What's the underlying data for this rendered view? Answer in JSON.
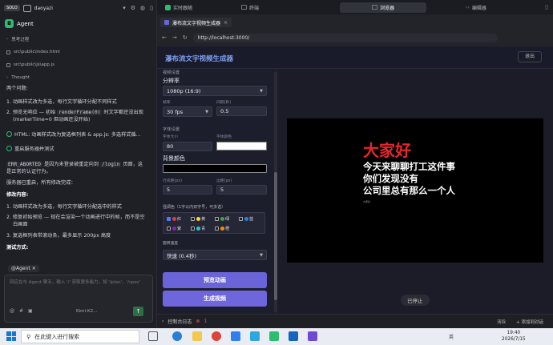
{
  "left": {
    "solo": "SOLO",
    "user": "daoyazi",
    "agent_title": "Agent",
    "think": "思考过程",
    "files": [
      "src\\public\\index.html",
      "src\\public\\js\\app.js"
    ],
    "thought": "Thought",
    "lines": {
      "q": "两个问题:",
      "l1": "1. 动画样式改为多选，每行文字循环分配不同样式",
      "l2": "2. 预览无响应 — 初始",
      "l2code": "renderFrame(0)",
      "l2b": "时文字都还没出现",
      "l2c": "(markerTime=0 但动画还没开始)",
      "html_item": "HTML: 动画样式改为复选框列表 & app.js: 多选样式循...",
      "restart": "重启服务器并测试",
      "aborted_code": "ERR_ABORTED",
      "aborted": "是因为未登录被重定向到",
      "login_code": "/login",
      "aborted2": "页面，这",
      "aborted3": "是正常的认证行为。",
      "updated": "服务器已重启，所有修改完成：",
      "mod_title": "修改内容:",
      "m1": "1. 动画样式改为多选，每行文字循环分配选中的样式",
      "m2": "2. 修复初始预览 — 现在会渲染一个动画进行中的帧，而不是空",
      "m2b": "白画面",
      "m3": "3. 复选框列表带滚动条，最多显示 200px 高度",
      "test": "测试方式:"
    },
    "chat_chip": "@Agent",
    "chat_placeholder": "回应在与 Agent 聊天，输入 '/' 获取更多能力。如 '/plan'、'/spec'",
    "model": "Kimi-K2..."
  },
  "tabs": [
    {
      "label": "实时跟随"
    },
    {
      "label": "终端"
    },
    {
      "label": "浏览器"
    },
    {
      "label": "编辑器"
    }
  ],
  "browser": {
    "tab_title": "瀑布流文字视频生成器",
    "url": "http://localhost:3000/"
  },
  "page": {
    "title": "瀑布流文字视频生成器",
    "exit": "退出",
    "video_section": "视频设置",
    "resolution_label": "分辨率",
    "resolution_value": "1080p (16:9)",
    "fps_label": "帧率",
    "fps_value": "30 fps",
    "interval_label": "间隔(秒)",
    "interval_value": "0.5",
    "font_section": "字体设置",
    "font_size_label": "字体大小",
    "font_size_value": "80",
    "font_color_label": "字体颜色",
    "bg_color_label": "背景颜色",
    "line_gap_label": "行间距(px)",
    "line_gap_value": "5",
    "margin_label": "边距(px)",
    "margin_value": "5",
    "accent_label": "强调色（1字以内双字号，可多选）",
    "colors": [
      {
        "label": "红",
        "hex": "#e53935",
        "on": true
      },
      {
        "label": "黄",
        "hex": "#fdd835",
        "on": false
      },
      {
        "label": "绿",
        "hex": "#43a047",
        "on": false
      },
      {
        "label": "蓝",
        "hex": "#1e88e5",
        "on": false
      },
      {
        "label": "紫",
        "hex": "#8e24aa",
        "on": false
      },
      {
        "label": "青",
        "hex": "#26c6da",
        "on": false
      },
      {
        "label": "橙",
        "hex": "#fb8c00",
        "on": false
      }
    ],
    "speed_label": "旋转速度",
    "speed_value": "快速 (0.4秒)",
    "preview_btn": "预览动画",
    "generate_btn": "生成视频",
    "video_lines": [
      "大家好",
      "今天来聊聊打工这件事",
      "你们发现没有",
      "公司里总有那么一个人"
    ],
    "video_small": "大家好",
    "stopped": "已停止"
  },
  "console": {
    "label": "控制台日志",
    "errors": "1",
    "clear": "清除",
    "add": "添加到对话"
  },
  "taskbar": {
    "search": "在此键入进行搜索",
    "tray": "英",
    "time": "19:40",
    "date": "2026/7/15"
  }
}
